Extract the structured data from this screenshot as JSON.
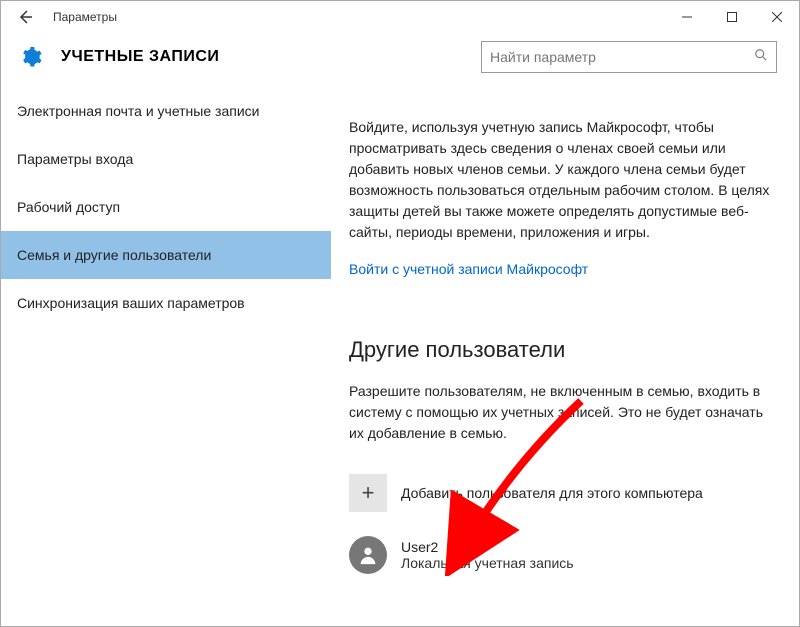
{
  "titlebar": {
    "title": "Параметры"
  },
  "header": {
    "title": "УЧЕТНЫЕ ЗАПИСИ"
  },
  "search": {
    "placeholder": "Найти параметр"
  },
  "sidebar": {
    "items": [
      {
        "label": "Электронная почта и учетные записи"
      },
      {
        "label": "Параметры входа"
      },
      {
        "label": "Рабочий доступ"
      },
      {
        "label": "Семья и другие пользователи"
      },
      {
        "label": "Синхронизация ваших параметров"
      }
    ],
    "active_index": 3
  },
  "main": {
    "intro": "Войдите, используя учетную запись Майкрософт, чтобы просматривать здесь сведения о членах своей семьи или добавить новых членов семьи. У каждого члена семьи будет возможность пользоваться отдельным рабочим столом. В целях защиты детей вы также можете определять допустимые веб-сайты, периоды времени, приложения и игры.",
    "signin_link": "Войти с учетной записи Майкрософт",
    "other_users_heading": "Другие пользователи",
    "other_users_desc": "Разрешите пользователям, не включенным в семью, входить в систему с помощью их учетных записей. Это не будет означать их добавление в семью.",
    "add_user_label": "Добавить пользователя для этого компьютера",
    "user": {
      "name": "User2",
      "type": "Локальная учетная запись"
    }
  }
}
